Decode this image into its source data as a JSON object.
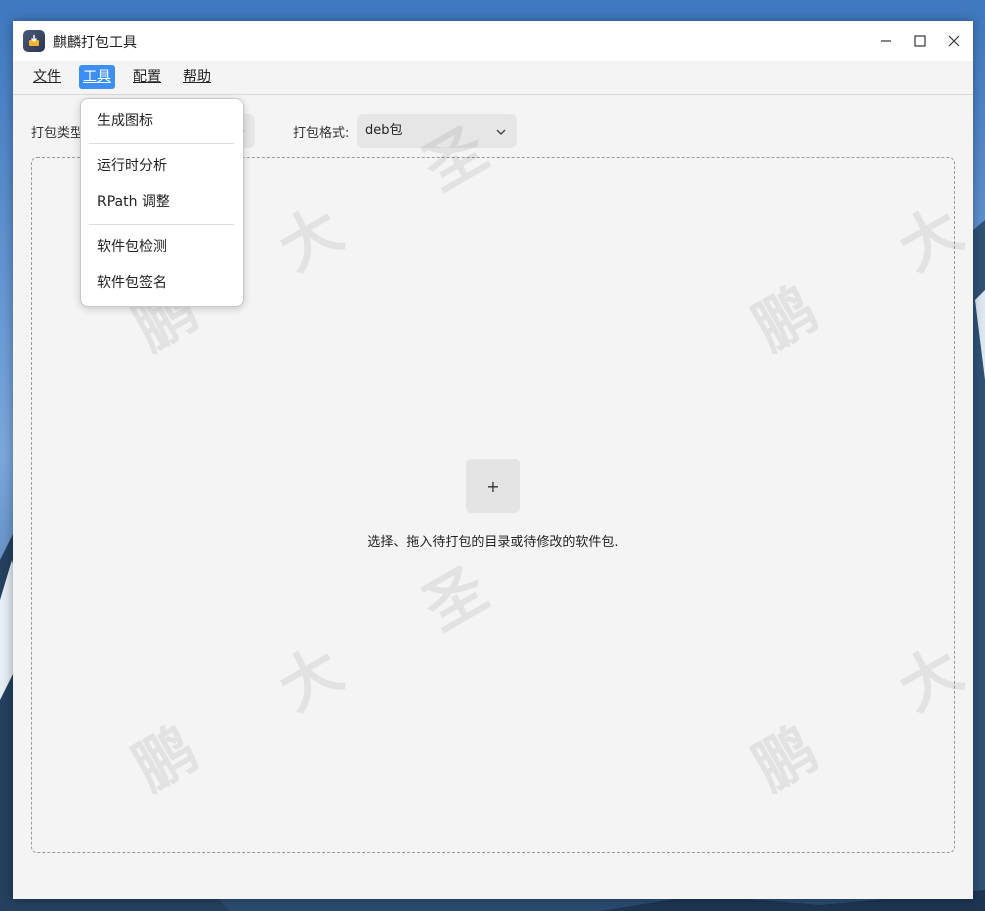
{
  "window": {
    "title": "麒麟打包工具",
    "minimize_glyph": "—",
    "maximize_glyph": "☐",
    "close_glyph": "✕"
  },
  "menubar": {
    "items": [
      {
        "label": "文件"
      },
      {
        "label": "工具"
      },
      {
        "label": "配置"
      },
      {
        "label": "帮助"
      }
    ],
    "active": "工具"
  },
  "tools_menu": {
    "items": [
      {
        "label": "生成图标"
      },
      {
        "label": "运行时分析"
      },
      {
        "label": "RPath 调整"
      },
      {
        "label": "软件包检测"
      },
      {
        "label": "软件包签名"
      }
    ]
  },
  "form": {
    "package_type_label": "打包类型",
    "package_format_label": "打包格式:",
    "package_format_value": "deb包"
  },
  "dropzone": {
    "add_glyph": "+",
    "hint": "选择、拖入待打包的目录或待修改的软件包."
  },
  "watermark": {
    "chars": [
      "鹏",
      "大",
      "圣"
    ]
  },
  "colors": {
    "accent": "#3d8ef2",
    "window_bg": "#f4f4f4",
    "titlebar_bg": "#ffffff"
  }
}
